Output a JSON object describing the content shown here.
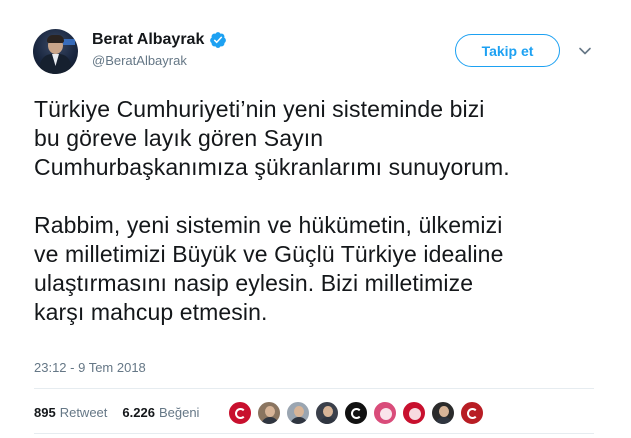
{
  "author": {
    "display_name": "Berat Albayrak",
    "handle": "@BeratAlbayrak",
    "verified": true
  },
  "follow_button": {
    "label": "Takip et"
  },
  "tweet": {
    "text": "Türkiye Cumhuriyeti’nin yeni sisteminde bizi\nbu göreve layık gören Sayın\nCumhurbaşkanımıza şükranlarımı sunuyorum.\n\nRabbim, yeni sistemin ve hükümetin, ülkemizi\nve milletimizi Büyük ve Güçlü Türkiye idealine\nulaştırmasını nasip eylesin. Bizi milletimize\nkarşı mahcup etmesin.",
    "timestamp": "23:12 - 9 Tem 2018"
  },
  "stats": {
    "retweets_count": "895",
    "retweets_label": "Retweet",
    "likes_count": "6.226",
    "likes_label": "Beğeni"
  },
  "likers": [
    {
      "name": "liker-1",
      "color": "#c8102e"
    },
    {
      "name": "liker-2",
      "color": "#8a7560"
    },
    {
      "name": "liker-3",
      "color": "#9aa5b1"
    },
    {
      "name": "liker-4",
      "color": "#3a3f4a"
    },
    {
      "name": "liker-5",
      "color": "#111111"
    },
    {
      "name": "liker-6",
      "color": "#d94c7a"
    },
    {
      "name": "liker-7",
      "color": "#c8102e"
    },
    {
      "name": "liker-8",
      "color": "#2b2b2b"
    },
    {
      "name": "liker-9",
      "color": "#b81d24"
    }
  ],
  "colors": {
    "accent": "#1da1f2",
    "text": "#14171a",
    "muted": "#657786"
  }
}
